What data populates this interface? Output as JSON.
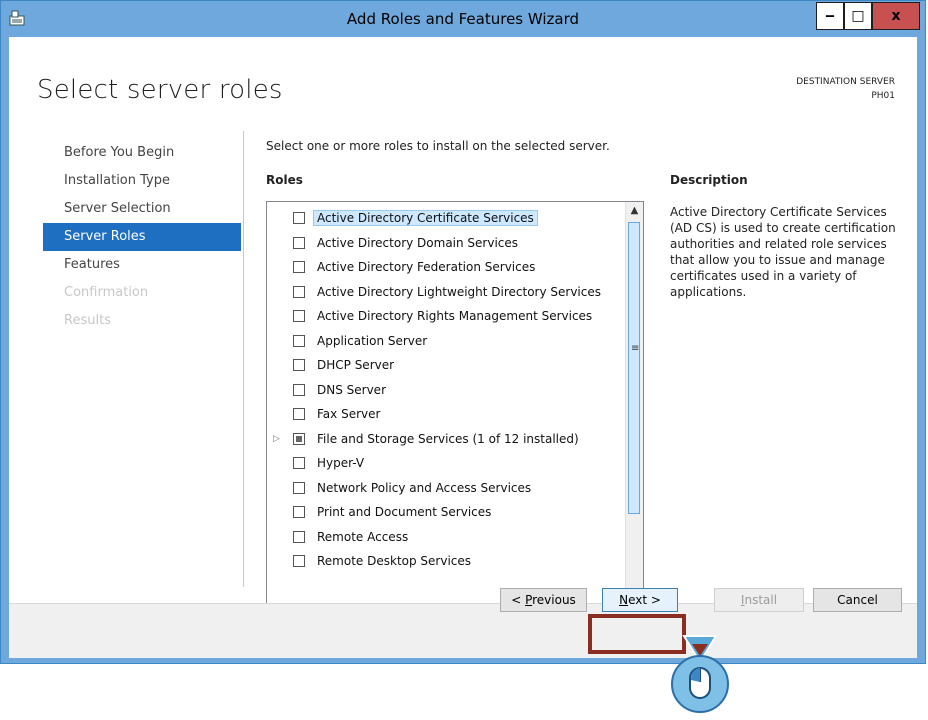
{
  "window": {
    "title": "Add Roles and Features Wizard",
    "min_symbol": "‒",
    "max_symbol": "□",
    "close_symbol": "x"
  },
  "page": {
    "heading": "Select server roles",
    "destination_label": "DESTINATION SERVER",
    "destination_value": "PH01",
    "instruction": "Select one or more roles to install on the selected server.",
    "roles_header": "Roles",
    "description_header": "Description",
    "description_text": "Active Directory Certificate Services (AD CS) is used to create certification authorities and related role services that allow you to issue and manage certificates used in a variety of applications."
  },
  "nav": {
    "items": [
      {
        "label": "Before You Begin",
        "state": "normal"
      },
      {
        "label": "Installation Type",
        "state": "normal"
      },
      {
        "label": "Server Selection",
        "state": "normal"
      },
      {
        "label": "Server Roles",
        "state": "active"
      },
      {
        "label": "Features",
        "state": "normal"
      },
      {
        "label": "Confirmation",
        "state": "disabled"
      },
      {
        "label": "Results",
        "state": "disabled"
      }
    ]
  },
  "roles": [
    {
      "label": "Active Directory Certificate Services",
      "selected": true,
      "partial": false,
      "expandable": false
    },
    {
      "label": "Active Directory Domain Services",
      "selected": false,
      "partial": false,
      "expandable": false
    },
    {
      "label": "Active Directory Federation Services",
      "selected": false,
      "partial": false,
      "expandable": false
    },
    {
      "label": "Active Directory Lightweight Directory Services",
      "selected": false,
      "partial": false,
      "expandable": false
    },
    {
      "label": "Active Directory Rights Management Services",
      "selected": false,
      "partial": false,
      "expandable": false
    },
    {
      "label": "Application Server",
      "selected": false,
      "partial": false,
      "expandable": false
    },
    {
      "label": "DHCP Server",
      "selected": false,
      "partial": false,
      "expandable": false
    },
    {
      "label": "DNS Server",
      "selected": false,
      "partial": false,
      "expandable": false
    },
    {
      "label": "Fax Server",
      "selected": false,
      "partial": false,
      "expandable": false
    },
    {
      "label": "File and Storage Services (1 of 12 installed)",
      "selected": false,
      "partial": true,
      "expandable": true
    },
    {
      "label": "Hyper-V",
      "selected": false,
      "partial": false,
      "expandable": false
    },
    {
      "label": "Network Policy and Access Services",
      "selected": false,
      "partial": false,
      "expandable": false
    },
    {
      "label": "Print and Document Services",
      "selected": false,
      "partial": false,
      "expandable": false
    },
    {
      "label": "Remote Access",
      "selected": false,
      "partial": false,
      "expandable": false
    },
    {
      "label": "Remote Desktop Services",
      "selected": false,
      "partial": false,
      "expandable": false
    }
  ],
  "buttons": {
    "previous_label": "< Previous",
    "next_label": "Next >",
    "install_label": "Install",
    "cancel_label": "Cancel"
  },
  "colors": {
    "accent": "#1e6fc2",
    "titlebar": "#6fa8dc",
    "highlight_box": "#8b2e22",
    "close_button": "#c75050"
  }
}
